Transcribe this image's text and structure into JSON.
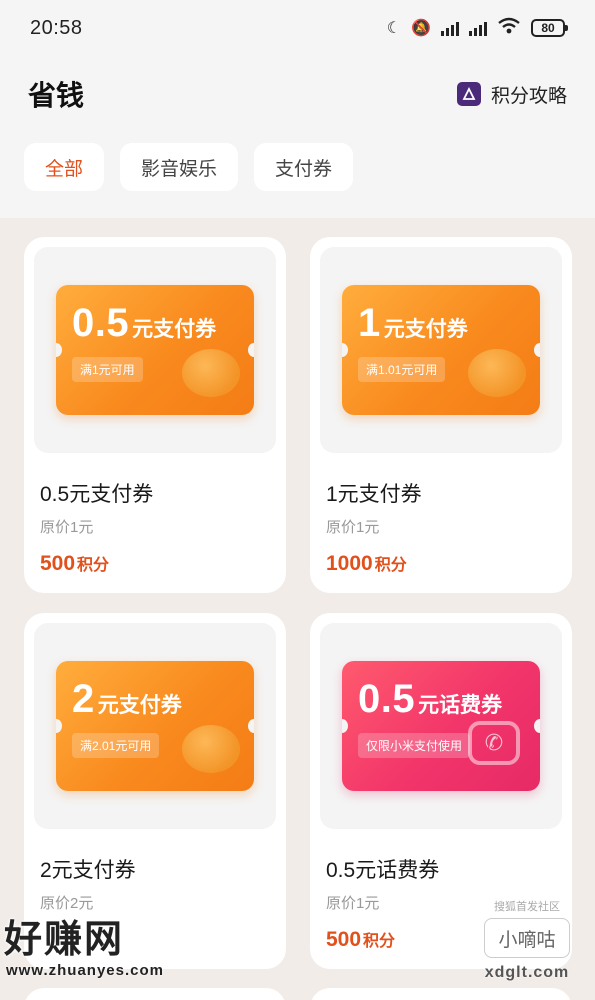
{
  "status_bar": {
    "time": "20:58",
    "battery": "80"
  },
  "header": {
    "title": "省钱",
    "guide_label": "积分攻略"
  },
  "tabs": [
    {
      "label": "全部",
      "active": true
    },
    {
      "label": "影音娱乐",
      "active": false
    },
    {
      "label": "支付券",
      "active": false
    }
  ],
  "cards": [
    {
      "amount": "0.5",
      "unit": "元支付券",
      "condition": "满1元可用",
      "name": "0.5元支付券",
      "original_price": "原价1元",
      "price": "500",
      "price_unit": "积分",
      "style": "orange"
    },
    {
      "amount": "1",
      "unit": "元支付券",
      "condition": "满1.01元可用",
      "name": "1元支付券",
      "original_price": "原价1元",
      "price": "1000",
      "price_unit": "积分",
      "style": "orange"
    },
    {
      "amount": "2",
      "unit": "元支付券",
      "condition": "满2.01元可用",
      "name": "2元支付券",
      "original_price": "原价2元",
      "price": "",
      "price_unit": "",
      "style": "orange"
    },
    {
      "amount": "0.5",
      "unit": "元话费券",
      "condition": "仅限小米支付使用",
      "name": "0.5元话费券",
      "original_price": "原价1元",
      "price": "500",
      "price_unit": "积分",
      "style": "pink"
    }
  ],
  "watermark_left": {
    "big": "好赚网",
    "small": "www.zhuanyes.com"
  },
  "watermark_right": {
    "top": "搜狐首发社区",
    "mid": "小嘀咕",
    "bottom": "xdglt.com"
  },
  "colors": {
    "accent": "#e2501c",
    "coupon_orange": "#f98a1e",
    "coupon_pink": "#f2356a",
    "guide_icon": "#4b2a7a"
  }
}
